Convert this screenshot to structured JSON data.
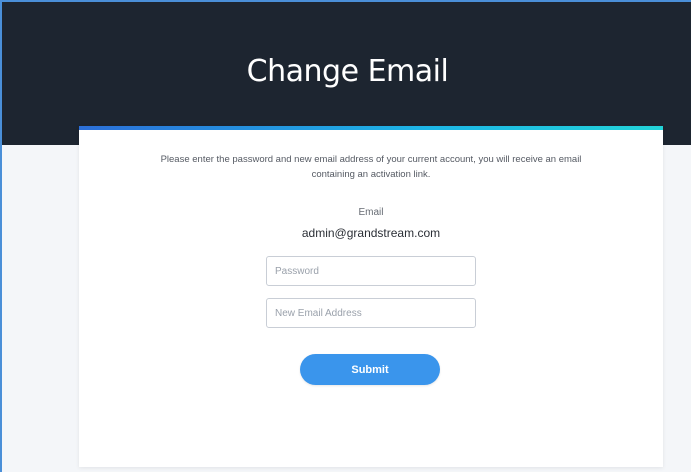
{
  "header": {
    "title": "Change Email"
  },
  "form": {
    "instructions": "Please enter the password and new email address of your current account, you will receive an email containing an activation link.",
    "email_label": "Email",
    "email_value": "admin@grandstream.com",
    "password": {
      "value": "",
      "placeholder": "Password"
    },
    "new_email": {
      "value": "",
      "placeholder": "New Email Address"
    },
    "submit_label": "Submit"
  },
  "colors": {
    "header_bg": "#1d2530",
    "accent_start": "#2c6fd8",
    "accent_end": "#23d3d8",
    "submit_bg": "#3a95ec"
  }
}
